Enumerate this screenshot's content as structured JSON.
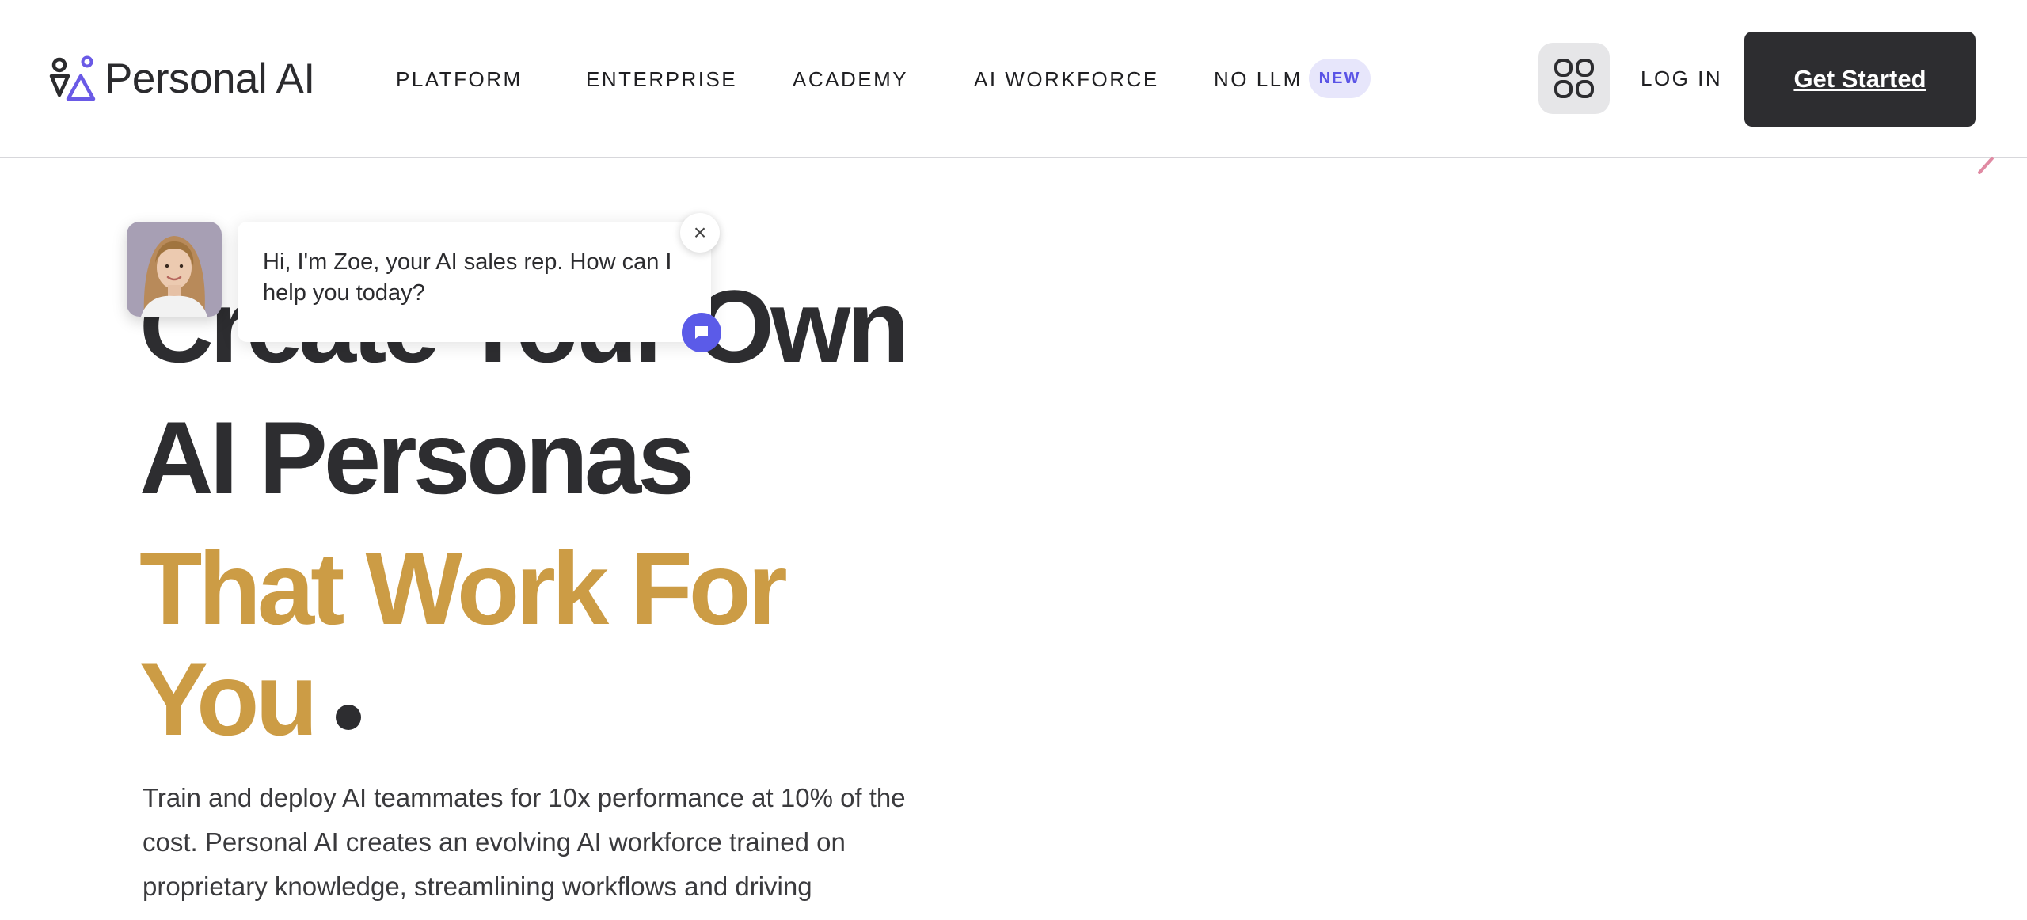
{
  "brand": {
    "name": "Personal AI"
  },
  "nav": {
    "items": [
      {
        "label": "PLATFORM"
      },
      {
        "label": "ENTERPRISE"
      },
      {
        "label": "ACADEMY"
      },
      {
        "label": "AI WORKFORCE"
      },
      {
        "label": "NO LLM"
      }
    ],
    "new_badge": "NEW",
    "login": "LOG IN",
    "cta": "Get Started"
  },
  "hero": {
    "line1": "Create Your Own",
    "line2": "AI Personas",
    "line3": "That Work For",
    "line4": "You",
    "lead": "Train and deploy AI teammates for 10x performance at 10% of the cost. Personal AI creates an evolving AI workforce trained on proprietary knowledge, streamlining workflows and driving"
  },
  "chat": {
    "message": "Hi, I'm Zoe, your AI sales rep. How can I help you today?",
    "close_symbol": "×"
  },
  "colors": {
    "accent_gold": "#cc9c45",
    "dark": "#2d2d30",
    "brand_purple": "#5b54e6",
    "badge_bg": "#e7e6fb"
  },
  "icons": [
    "brand-logo-icon",
    "apps-grid-icon",
    "close-icon",
    "chat-icon"
  ]
}
